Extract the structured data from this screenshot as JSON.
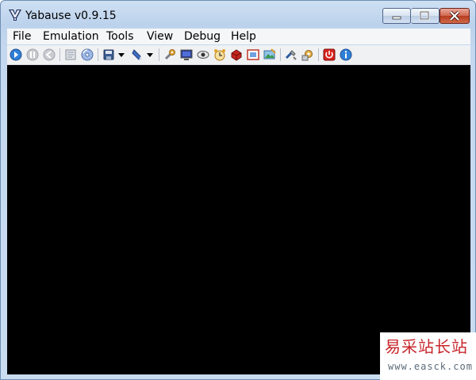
{
  "window": {
    "title": "Yabause v0.9.15"
  },
  "menubar": {
    "items": [
      "File",
      "Emulation",
      "Tools",
      "View",
      "Debug",
      "Help"
    ]
  },
  "toolbar": {
    "icons": [
      "run-icon",
      "pause-icon",
      "reset-icon",
      "open-iso-icon",
      "open-cd-icon",
      "save-state-icon",
      "save-state-dropdown-icon",
      "load-state-icon",
      "load-state-dropdown-icon",
      "settings-icon",
      "screen-icon",
      "eye-icon",
      "clock-icon",
      "debug-icon",
      "fullscreen-icon",
      "screenshot-icon",
      "tools-icon",
      "gear-icon",
      "quit-icon",
      "about-icon"
    ]
  },
  "watermark": {
    "title": "易采站长站",
    "url": "www.easck.com"
  },
  "colors": {
    "titlebar": "#bcd2ec",
    "close_button": "#c94b2e",
    "screen": "#000000",
    "watermark_red": "#c8262a"
  }
}
